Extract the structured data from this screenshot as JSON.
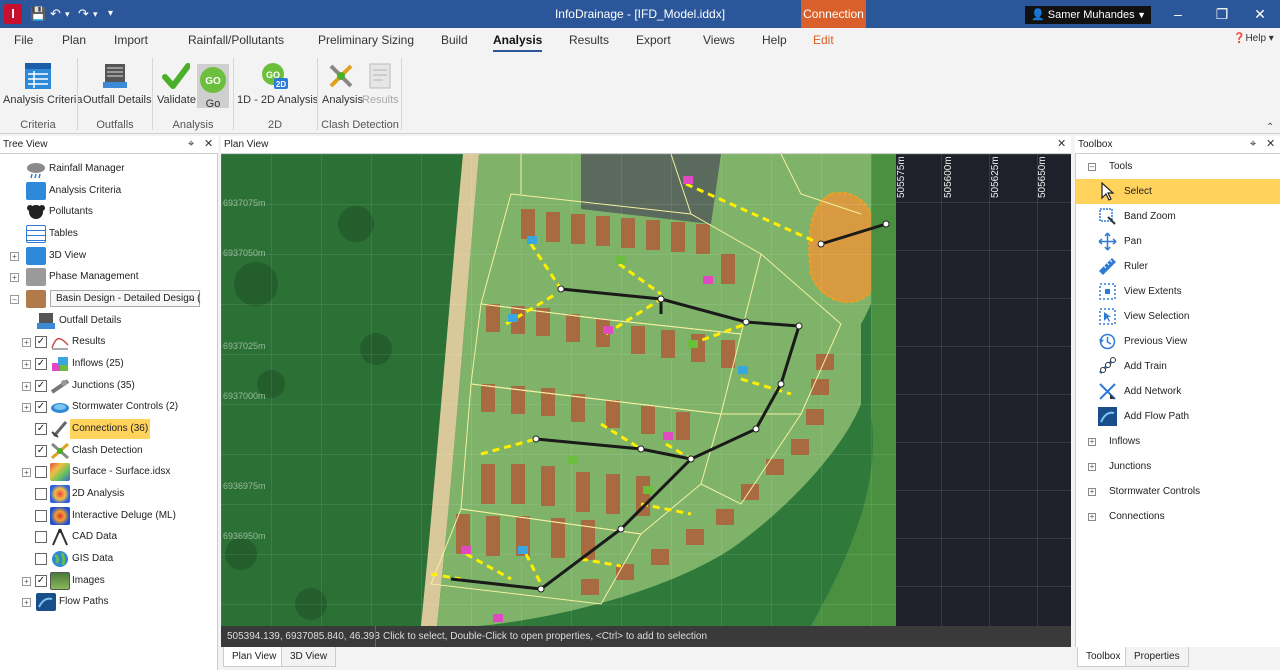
{
  "titlebar": {
    "app_icon": "I",
    "title": "InfoDrainage - [IFD_Model.iddx]",
    "context_tab": "Connection",
    "user": "Samer Muhandes",
    "qat": {
      "save": "save-icon",
      "undo": "undo-icon",
      "redo": "redo-icon",
      "customize": "customize-icon"
    }
  },
  "menu": {
    "file": "File",
    "plan": "Plan",
    "import": "Import",
    "rainfall": "Rainfall/Pollutants",
    "prelim": "Preliminary Sizing",
    "build": "Build",
    "analysis": "Analysis",
    "results": "Results",
    "export": "Export",
    "views": "Views",
    "help": "Help",
    "edit": "Edit",
    "help_link": "Help"
  },
  "ribbon": {
    "analysis_criteria": "Analysis Criteria",
    "outfall_details": "Outfall Details",
    "validate": "Validate",
    "go": "Go",
    "go_badge": "GO",
    "go2d_badge": "GO",
    "go2d_sub": "2D",
    "analysis_1d2d": "1D - 2D Analysis",
    "clash_analysis": "Analysis",
    "clash_results": "Results",
    "groups": {
      "criteria": "Criteria",
      "outfalls": "Outfalls",
      "analysis": "Analysis",
      "twod": "2D",
      "clash": "Clash Detection"
    }
  },
  "tree_view": {
    "title": "Tree View",
    "items": [
      {
        "label": "Rainfall Manager"
      },
      {
        "label": "Analysis Criteria"
      },
      {
        "label": "Pollutants"
      },
      {
        "label": "Tables"
      },
      {
        "label": "3D View"
      },
      {
        "label": "Phase Management"
      },
      {
        "label": "Basin Design - Detailed Design (",
        "selected_value": "Basin Design - Detailed Design ("
      },
      {
        "label": "Outfall Details"
      },
      {
        "label": "Results"
      },
      {
        "label": "Inflows (25)"
      },
      {
        "label": "Junctions (35)"
      },
      {
        "label": "Stormwater Controls (2)"
      },
      {
        "label": "Connections (36)"
      },
      {
        "label": "Clash Detection"
      },
      {
        "label": "Surface - Surface.idsx"
      },
      {
        "label": "2D Analysis"
      },
      {
        "label": "Interactive Deluge (ML)"
      },
      {
        "label": "CAD Data"
      },
      {
        "label": "GIS Data"
      },
      {
        "label": "Images"
      },
      {
        "label": "Flow Paths"
      }
    ]
  },
  "plan_view": {
    "title": "Plan View",
    "grid_labels_x": [
      "505575m",
      "505600m",
      "505625m",
      "505650m"
    ],
    "grid_labels_y": [
      "6937075m",
      "6937050m",
      "6937025m",
      "6937000m",
      "6936975m",
      "6936950m"
    ],
    "status_coords": "505394.139, 6937085.840, 46.393",
    "status_hint": "Click to select, Double-Click to open properties, <Ctrl> to add to selection",
    "tabs": [
      "Plan View",
      "3D View"
    ]
  },
  "toolbox": {
    "title": "Toolbox",
    "section": "Tools",
    "tools": [
      {
        "label": "Select",
        "icon": "cursor-icon"
      },
      {
        "label": "Band Zoom",
        "icon": "band-zoom-icon"
      },
      {
        "label": "Pan",
        "icon": "pan-icon"
      },
      {
        "label": "Ruler",
        "icon": "ruler-icon"
      },
      {
        "label": "View Extents",
        "icon": "view-extents-icon"
      },
      {
        "label": "View Selection",
        "icon": "view-selection-icon"
      },
      {
        "label": "Previous View",
        "icon": "previous-view-icon"
      },
      {
        "label": "Add Train",
        "icon": "add-train-icon"
      },
      {
        "label": "Add Network",
        "icon": "add-network-icon"
      },
      {
        "label": "Add Flow Path",
        "icon": "add-flow-path-icon"
      }
    ],
    "categories": [
      "Inflows",
      "Junctions",
      "Stormwater Controls",
      "Connections"
    ],
    "tabs": [
      "Toolbox",
      "Properties"
    ]
  },
  "colors": {
    "titlebar": "#2b579a",
    "context": "#d9602a",
    "highlight": "#ffd35c",
    "network": "#ffee00"
  }
}
